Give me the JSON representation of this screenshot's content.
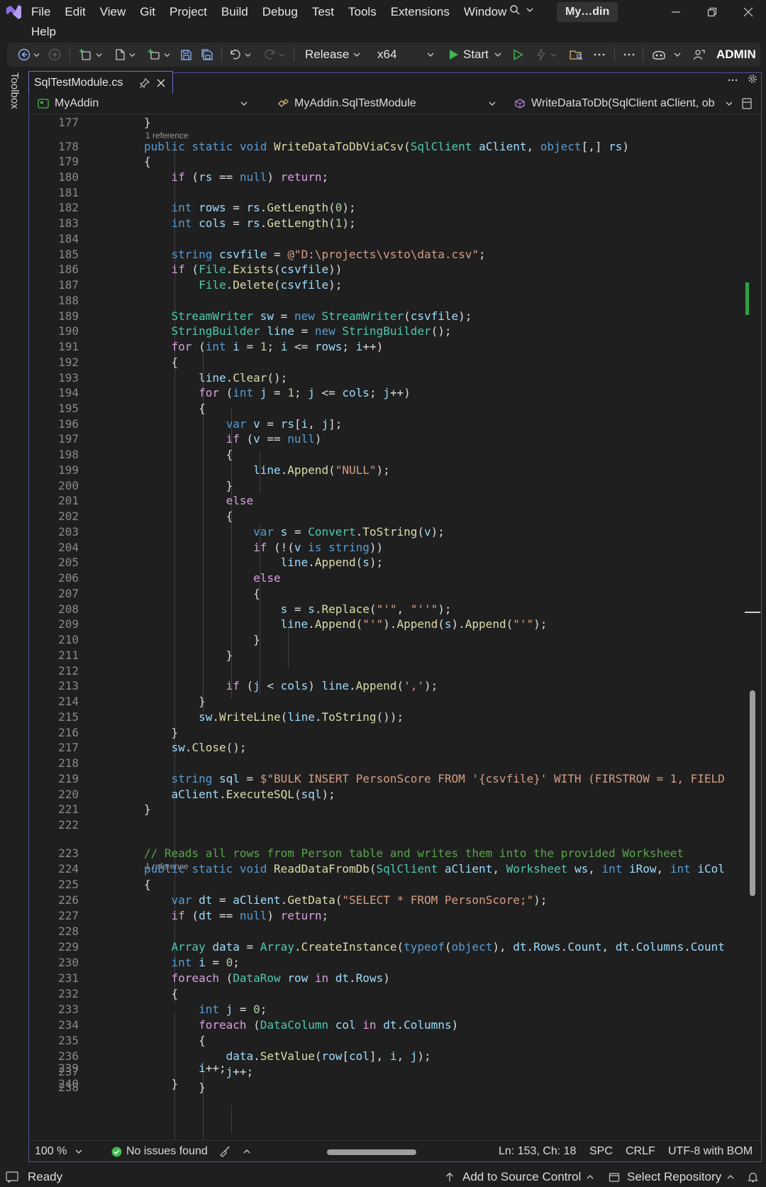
{
  "menubar": {
    "items_row1": [
      "File",
      "Edit",
      "View",
      "Git",
      "Project",
      "Build",
      "Debug",
      "Test",
      "Tools",
      "Extensions",
      "Window"
    ],
    "items_row2": [
      "Help"
    ],
    "title": "My…din"
  },
  "toolbar": {
    "configuration": "Release",
    "platform": "x64",
    "start_label": "Start",
    "user_label": "ADMIN"
  },
  "toolbox_label": "Toolbox",
  "document_tab": {
    "label": "SqlTestModule.cs"
  },
  "navbar": {
    "project": "MyAddin",
    "class": "MyAddin.SqlTestModule",
    "member": "WriteDataToDb(SqlClient aClient, ob"
  },
  "code": {
    "codelens_1": "1 reference",
    "codelens_2": "1 reference",
    "lines": [
      {
        "n": "177",
        "text": "        }"
      },
      {
        "n": "178",
        "text": "        public static void WriteDataToDbViaCsv(SqlClient aClient, object[,] rs)"
      },
      {
        "n": "179",
        "text": "        {"
      },
      {
        "n": "180",
        "text": "            if (rs == null) return;"
      },
      {
        "n": "181",
        "text": ""
      },
      {
        "n": "182",
        "text": "            int rows = rs.GetLength(0);"
      },
      {
        "n": "183",
        "text": "            int cols = rs.GetLength(1);"
      },
      {
        "n": "184",
        "text": ""
      },
      {
        "n": "185",
        "text": "            string csvfile = @\"D:\\projects\\vsto\\data.csv\";"
      },
      {
        "n": "186",
        "text": "            if (File.Exists(csvfile))"
      },
      {
        "n": "187",
        "text": "                File.Delete(csvfile);"
      },
      {
        "n": "188",
        "text": ""
      },
      {
        "n": "189",
        "text": "            StreamWriter sw = new StreamWriter(csvfile);"
      },
      {
        "n": "190",
        "text": "            StringBuilder line = new StringBuilder();"
      },
      {
        "n": "191",
        "text": "            for (int i = 1; i <= rows; i++)"
      },
      {
        "n": "192",
        "text": "            {"
      },
      {
        "n": "193",
        "text": "                line.Clear();"
      },
      {
        "n": "194",
        "text": "                for (int j = 1; j <= cols; j++)"
      },
      {
        "n": "195",
        "text": "                {"
      },
      {
        "n": "196",
        "text": "                    var v = rs[i, j];"
      },
      {
        "n": "197",
        "text": "                    if (v == null)"
      },
      {
        "n": "198",
        "text": "                    {"
      },
      {
        "n": "199",
        "text": "                        line.Append(\"NULL\");"
      },
      {
        "n": "200",
        "text": "                    }"
      },
      {
        "n": "201",
        "text": "                    else"
      },
      {
        "n": "202",
        "text": "                    {"
      },
      {
        "n": "203",
        "text": "                        var s = Convert.ToString(v);"
      },
      {
        "n": "204",
        "text": "                        if (!(v is string))"
      },
      {
        "n": "205",
        "text": "                            line.Append(s);"
      },
      {
        "n": "206",
        "text": "                        else"
      },
      {
        "n": "207",
        "text": "                        {"
      },
      {
        "n": "208",
        "text": "                            s = s.Replace(\"'\", \"''\");"
      },
      {
        "n": "209",
        "text": "                            line.Append(\"'\").Append(s).Append(\"'\");"
      },
      {
        "n": "210",
        "text": "                        }"
      },
      {
        "n": "211",
        "text": "                    }"
      },
      {
        "n": "212",
        "text": ""
      },
      {
        "n": "213",
        "text": "                    if (j < cols) line.Append(',');"
      },
      {
        "n": "214",
        "text": "                }"
      },
      {
        "n": "215",
        "text": "                sw.WriteLine(line.ToString());"
      },
      {
        "n": "216",
        "text": "            }"
      },
      {
        "n": "217",
        "text": "            sw.Close();"
      },
      {
        "n": "218",
        "text": ""
      },
      {
        "n": "219",
        "text": "            string sql = $\"BULK INSERT PersonScore FROM '{csvfile}' WITH (FIRSTROW = 1, FIELD"
      },
      {
        "n": "220",
        "text": "            aClient.ExecuteSQL(sql);"
      },
      {
        "n": "221",
        "text": "        }"
      },
      {
        "n": "222",
        "text": ""
      },
      {
        "n": "223",
        "text": "        // Reads all rows from Person table and writes them into the provided Worksheet"
      },
      {
        "n": "224",
        "text": "        public static void ReadDataFromDb(SqlClient aClient, Worksheet ws, int iRow, int iCol"
      },
      {
        "n": "225",
        "text": "        {"
      },
      {
        "n": "226",
        "text": "            var dt = aClient.GetData(\"SELECT * FROM PersonScore;\");"
      },
      {
        "n": "227",
        "text": "            if (dt == null) return;"
      },
      {
        "n": "228",
        "text": ""
      },
      {
        "n": "229",
        "text": "            Array data = Array.CreateInstance(typeof(object), dt.Rows.Count, dt.Columns.Count"
      },
      {
        "n": "230",
        "text": "            int i = 0;"
      },
      {
        "n": "231",
        "text": "            foreach (DataRow row in dt.Rows)"
      },
      {
        "n": "232",
        "text": "            {"
      },
      {
        "n": "233",
        "text": "                int j = 0;"
      },
      {
        "n": "234",
        "text": "                foreach (DataColumn col in dt.Columns)"
      },
      {
        "n": "235",
        "text": "                {"
      },
      {
        "n": "236",
        "text": "                    data.SetValue(row[col], i, j);"
      },
      {
        "n": "237",
        "text": "                    j++;"
      },
      {
        "n": "238",
        "text": "                }"
      },
      {
        "n": "239",
        "text": "                i++;"
      },
      {
        "n": "240",
        "text": "            }"
      }
    ]
  },
  "editor_status": {
    "zoom": "100 %",
    "issues": "No issues found",
    "position": "Ln: 153, Ch: 18",
    "indent": "SPC",
    "line_ending": "CRLF",
    "encoding": "UTF-8 with BOM"
  },
  "statusbar": {
    "state": "Ready",
    "source_control": "Add to Source Control",
    "repository": "Select Repository"
  },
  "colors": {
    "background": "#1f1f1f",
    "keyword": "#569cd6",
    "control_keyword": "#d8a0df",
    "type": "#4ec9b0",
    "method": "#dcdcaa",
    "variable": "#9cdcfe",
    "string": "#d69d85",
    "comment": "#57a64a",
    "accent_frame": "#6c6cc6",
    "start_green": "#3fb950"
  }
}
